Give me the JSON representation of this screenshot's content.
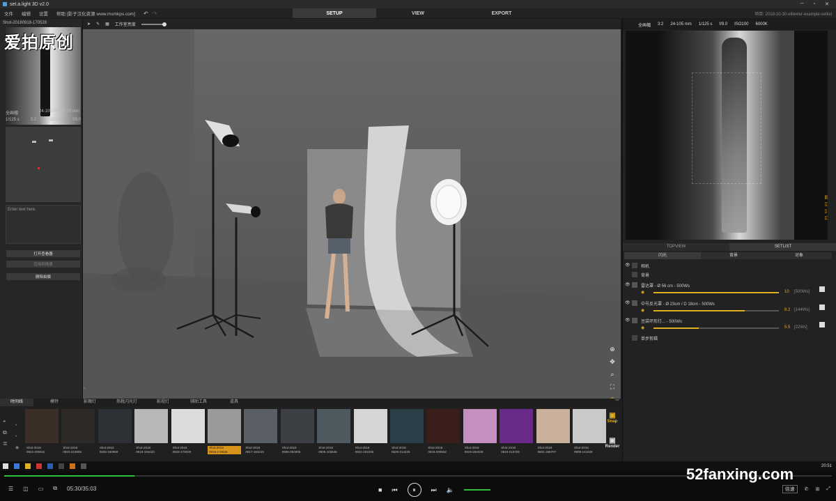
{
  "app": {
    "title": "set.a.light 3D v2.0",
    "project_path": "项目: 2018-10-30-elitexler-example-setlist"
  },
  "menu": [
    "文件",
    "编辑",
    "设置",
    "帮助 [影子汉化资源 www.msmkps.com]"
  ],
  "modes": {
    "setup": "SETUP",
    "view": "VIEW",
    "export": "EXPORT"
  },
  "left": {
    "shot_name": "Shot-20180918-170528",
    "watermark": "爱拍原创",
    "camera_format": "全画幅",
    "lens": "24-105 mm @ 70 mm",
    "shutter": "1/125 s",
    "ratio": "3:2",
    "iso": "ISO100",
    "aperture": "f/9.0",
    "notes_placeholder": "Enter text here.",
    "btn_open": "打开查看器",
    "btn_apply": "应用到场景",
    "btn_delete": "删除拍摄"
  },
  "viewport_toolbar": {
    "brightness_label": "工作室亮度"
  },
  "camera_bar": {
    "format": "全画幅",
    "ratio": "3:2",
    "lens": "24-105 mm",
    "shutter": "1/125 s",
    "aperture": "f/9.0",
    "iso": "ISO100",
    "kelvin": "6000K"
  },
  "right_tabs": {
    "topview": "TOPVIEW",
    "setlist": "SETLIST"
  },
  "setlist_subtabs": [
    "闪光",
    "背景",
    "对象"
  ],
  "setlist": [
    {
      "name": "相机"
    },
    {
      "name": "背景"
    },
    {
      "name": "雷达罩 - Ø 56 cm - 500Ws",
      "value": "10",
      "ws": "[500Ws]",
      "level": 1.0
    },
    {
      "name": "中号反光罩 - Ø 23cm / D 18cm - 500Ws",
      "value": "8.2",
      "ws": "[144Ws]",
      "level": 0.73
    },
    {
      "name": "豆袋环形灯... - 500Ws",
      "value": "5.5",
      "ws": "[22Ws]",
      "level": 0.36
    },
    {
      "name": "单步剪辑"
    }
  ],
  "bottom_tabs": [
    "时间线",
    "模特",
    "影棚灯",
    "热靴闪光灯",
    "影视灯",
    "辅助工具",
    "道具"
  ],
  "shots": [
    {
      "t": "Shot-2018",
      "d": "0922-205942"
    },
    {
      "t": "Shot-2018",
      "d": "0922-210809"
    },
    {
      "t": "Shot-2018",
      "d": "0828-160959"
    },
    {
      "t": "Shot-2018",
      "d": "0918-165433"
    },
    {
      "t": "Shot-2018",
      "d": "0918-170028"
    },
    {
      "t": "Shot-2018",
      "d": "0918-170528"
    },
    {
      "t": "Shot-2018",
      "d": "0917-183215"
    },
    {
      "t": "Shot-2018",
      "d": "0906-094906"
    },
    {
      "t": "Shot-2018",
      "d": "0906-103646"
    },
    {
      "t": "Shot-2018",
      "d": "0922-191035"
    },
    {
      "t": "Shot-2018",
      "d": "0828-214229"
    },
    {
      "t": "Shot-2018",
      "d": "0919-200932"
    },
    {
      "t": "Shot-2018",
      "d": "0919-204028"
    },
    {
      "t": "Shot-2018",
      "d": "0919-210725"
    },
    {
      "t": "Shot-2018",
      "d": "0801-165707"
    },
    {
      "t": "Shot-2018",
      "d": "0908-141628"
    }
  ],
  "side_buttons": {
    "snap": "Snap",
    "render": "Render"
  },
  "taskbar": {
    "clock": "20:51"
  },
  "player": {
    "time": "05:30/35:03",
    "speed": "倍速",
    "progress": 0.157
  },
  "site_watermark": "52fanxing.com"
}
